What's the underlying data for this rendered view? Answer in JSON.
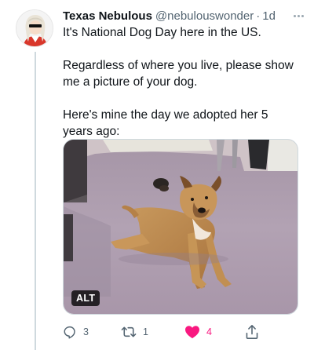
{
  "tweet": {
    "author": {
      "display_name": "Texas Nebulous",
      "handle": "@nebulouswonder"
    },
    "separator": "·",
    "time": "1d",
    "text": [
      "It's National Dog Day here in the US.",
      "Regardless of where you live, please show me a picture of your dog.",
      "Here's mine the day we adopted her 5 years ago:"
    ],
    "media": {
      "alt_label": "ALT"
    },
    "actions": {
      "replies": "3",
      "retweets": "1",
      "likes": "4"
    }
  },
  "icons": {
    "more": "more-horizontal-icon",
    "reply": "reply-icon",
    "retweet": "retweet-icon",
    "like": "heart-filled-icon",
    "share": "share-icon"
  },
  "colors": {
    "like": "#f91880",
    "secondary_text": "#536471",
    "thread_line": "#cfd9de"
  }
}
